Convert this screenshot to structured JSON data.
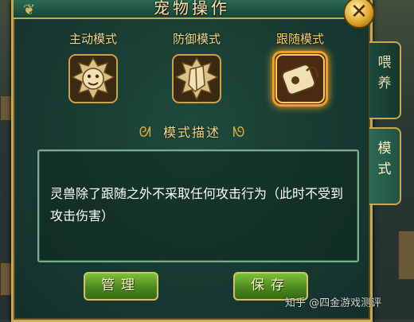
{
  "window": {
    "title": "宠物操作",
    "close_label": "✕"
  },
  "side_tabs": [
    {
      "label_1": "喂",
      "label_2": "养",
      "active": false
    },
    {
      "label_1": "模",
      "label_2": "式",
      "active": true
    }
  ],
  "modes": [
    {
      "label": "主动模式",
      "icon": "active-lion-icon",
      "selected": false
    },
    {
      "label": "防御模式",
      "icon": "defense-shield-icon",
      "selected": false
    },
    {
      "label": "跟随模式",
      "icon": "follow-bell-icon",
      "selected": true
    }
  ],
  "description": {
    "title": "模式描述",
    "text": "灵兽除了跟随之外不采取任何攻击行为（此时不受到攻击伤害）"
  },
  "buttons": {
    "manage": "管理",
    "save": "保存"
  },
  "watermark": "知乎 @四金游戏测评"
}
